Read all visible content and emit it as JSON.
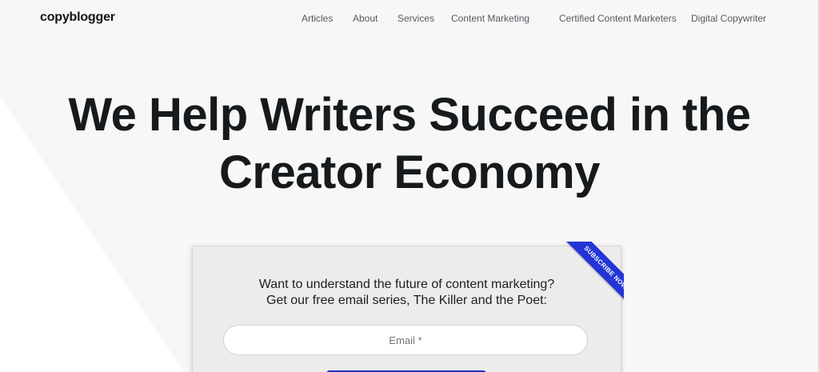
{
  "brand": {
    "logo_text": "copyblogger"
  },
  "nav": {
    "items": [
      {
        "label": "Articles"
      },
      {
        "label": "About"
      },
      {
        "label": "Services"
      },
      {
        "label": "Content Marketing"
      },
      {
        "label": "Certified Content Marketers"
      },
      {
        "label": "Digital Copywriter"
      }
    ]
  },
  "hero": {
    "title_line1": "We Help Writers Succeed in the",
    "title_line2": "Creator Economy"
  },
  "signup": {
    "text_line1": "Want to understand the future of content marketing?",
    "text_line2": "Get our free email series, The Killer and the Poet:",
    "email_placeholder": "Email *",
    "ribbon_label": "SUBSCRIBE NOW"
  },
  "colors": {
    "accent": "#2335d6",
    "text_dark": "#161a1d",
    "nav_text": "#555a60"
  }
}
